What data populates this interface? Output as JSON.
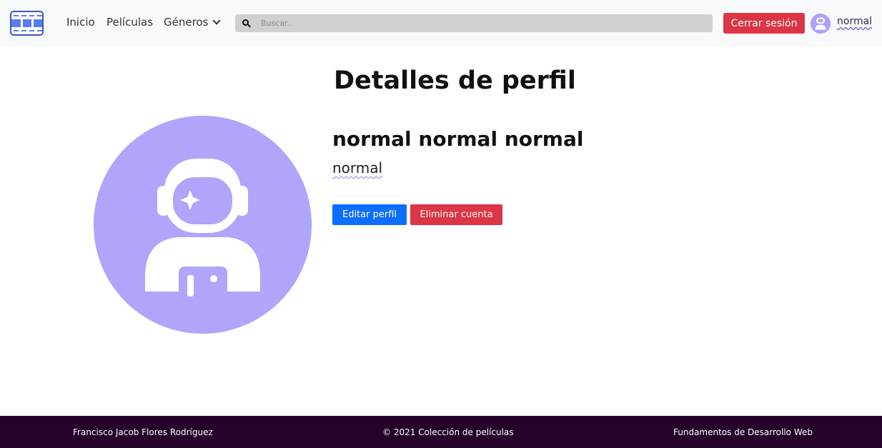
{
  "navbar": {
    "links": {
      "inicio": "Inicio",
      "peliculas": "Películas",
      "generos": "Géneros"
    },
    "search_placeholder": "Buscar..",
    "logout_label": "Cerrar sesión",
    "username": "normal",
    "icons": [
      "film-logo-icon",
      "chevron-down-icon",
      "search-icon",
      "astronaut-avatar-icon"
    ]
  },
  "profile": {
    "page_title": "Detalles de perfil",
    "full_name": "normal normal normal",
    "username": "normal",
    "edit_label": "Editar perfil",
    "delete_label": "Eliminar cuenta"
  },
  "footer": {
    "author": "Francisco Jacob Flores Rodríguez",
    "copyright": "© 2021 Colección de películas",
    "course": "Fundamentos de Desarrollo Web"
  },
  "colors": {
    "primary": "#0d6efd",
    "danger": "#dc3545",
    "avatar": "#afa5fb",
    "footer_bg": "#24002b",
    "navbar_bg": "#f8f9fa"
  }
}
